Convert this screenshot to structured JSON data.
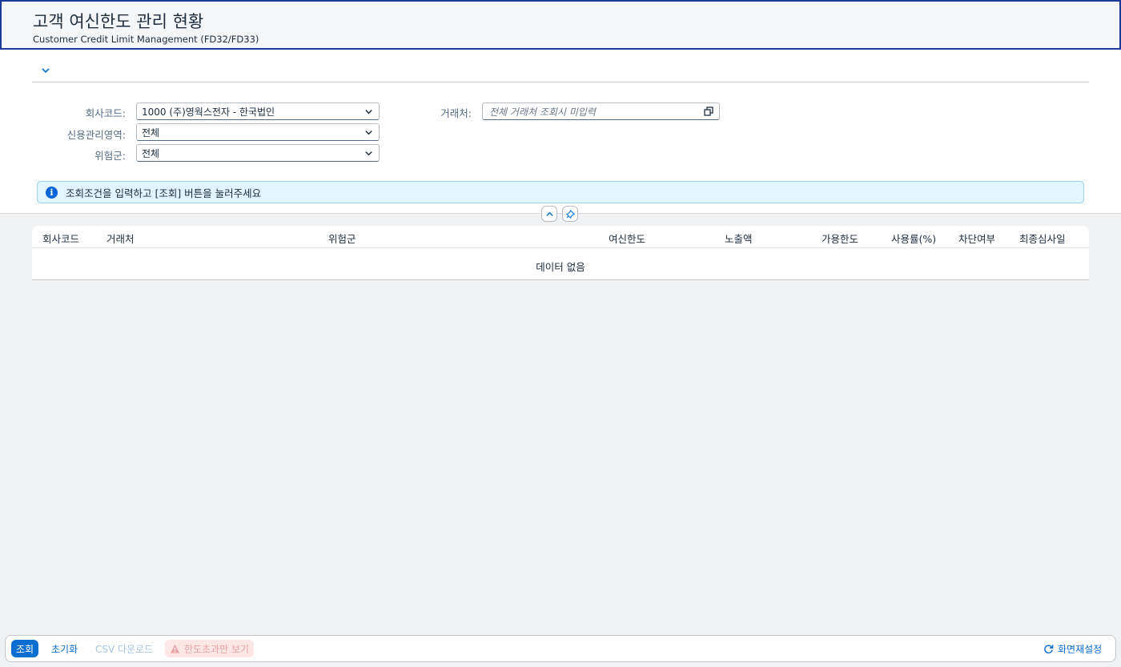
{
  "header": {
    "title": "고객 여신한도 관리 현황",
    "subtitle": "Customer Credit Limit Management (FD32/FD33)"
  },
  "filters": {
    "company_code": {
      "label": "회사코드:",
      "value": "1000 (주)영웍스전자 - 한국법인"
    },
    "credit_area": {
      "label": "신용관리영역:",
      "value": "전체"
    },
    "risk_group": {
      "label": "위험군:",
      "value": "전체"
    },
    "customer": {
      "label": "거래처:",
      "placeholder": "전체 거래처 조회시 미입력"
    }
  },
  "info_message": "조회조건을 입력하고 [조회] 버튼을 눌러주세요",
  "table": {
    "columns": [
      "회사코드",
      "거래처",
      "위험군",
      "여신한도",
      "노출액",
      "가용한도",
      "사용률(%)",
      "차단여부",
      "최종심사일"
    ],
    "empty_text": "데이터 없음"
  },
  "footer": {
    "search": "조회",
    "reset": "초기화",
    "csv": "CSV 다운로드",
    "over_limit": "한도초과만 보기",
    "screen_reset": "화면재설정"
  },
  "colors": {
    "accent": "#0a6ed1",
    "header_border": "#1a3a9c",
    "info_bg": "#e1f4ff",
    "warn_bg": "#fde6e6"
  },
  "icons": [
    "chevron-down-icon",
    "value-help-icon",
    "info-icon",
    "collapse-up-icon",
    "pin-icon",
    "warning-icon",
    "refresh-icon"
  ]
}
